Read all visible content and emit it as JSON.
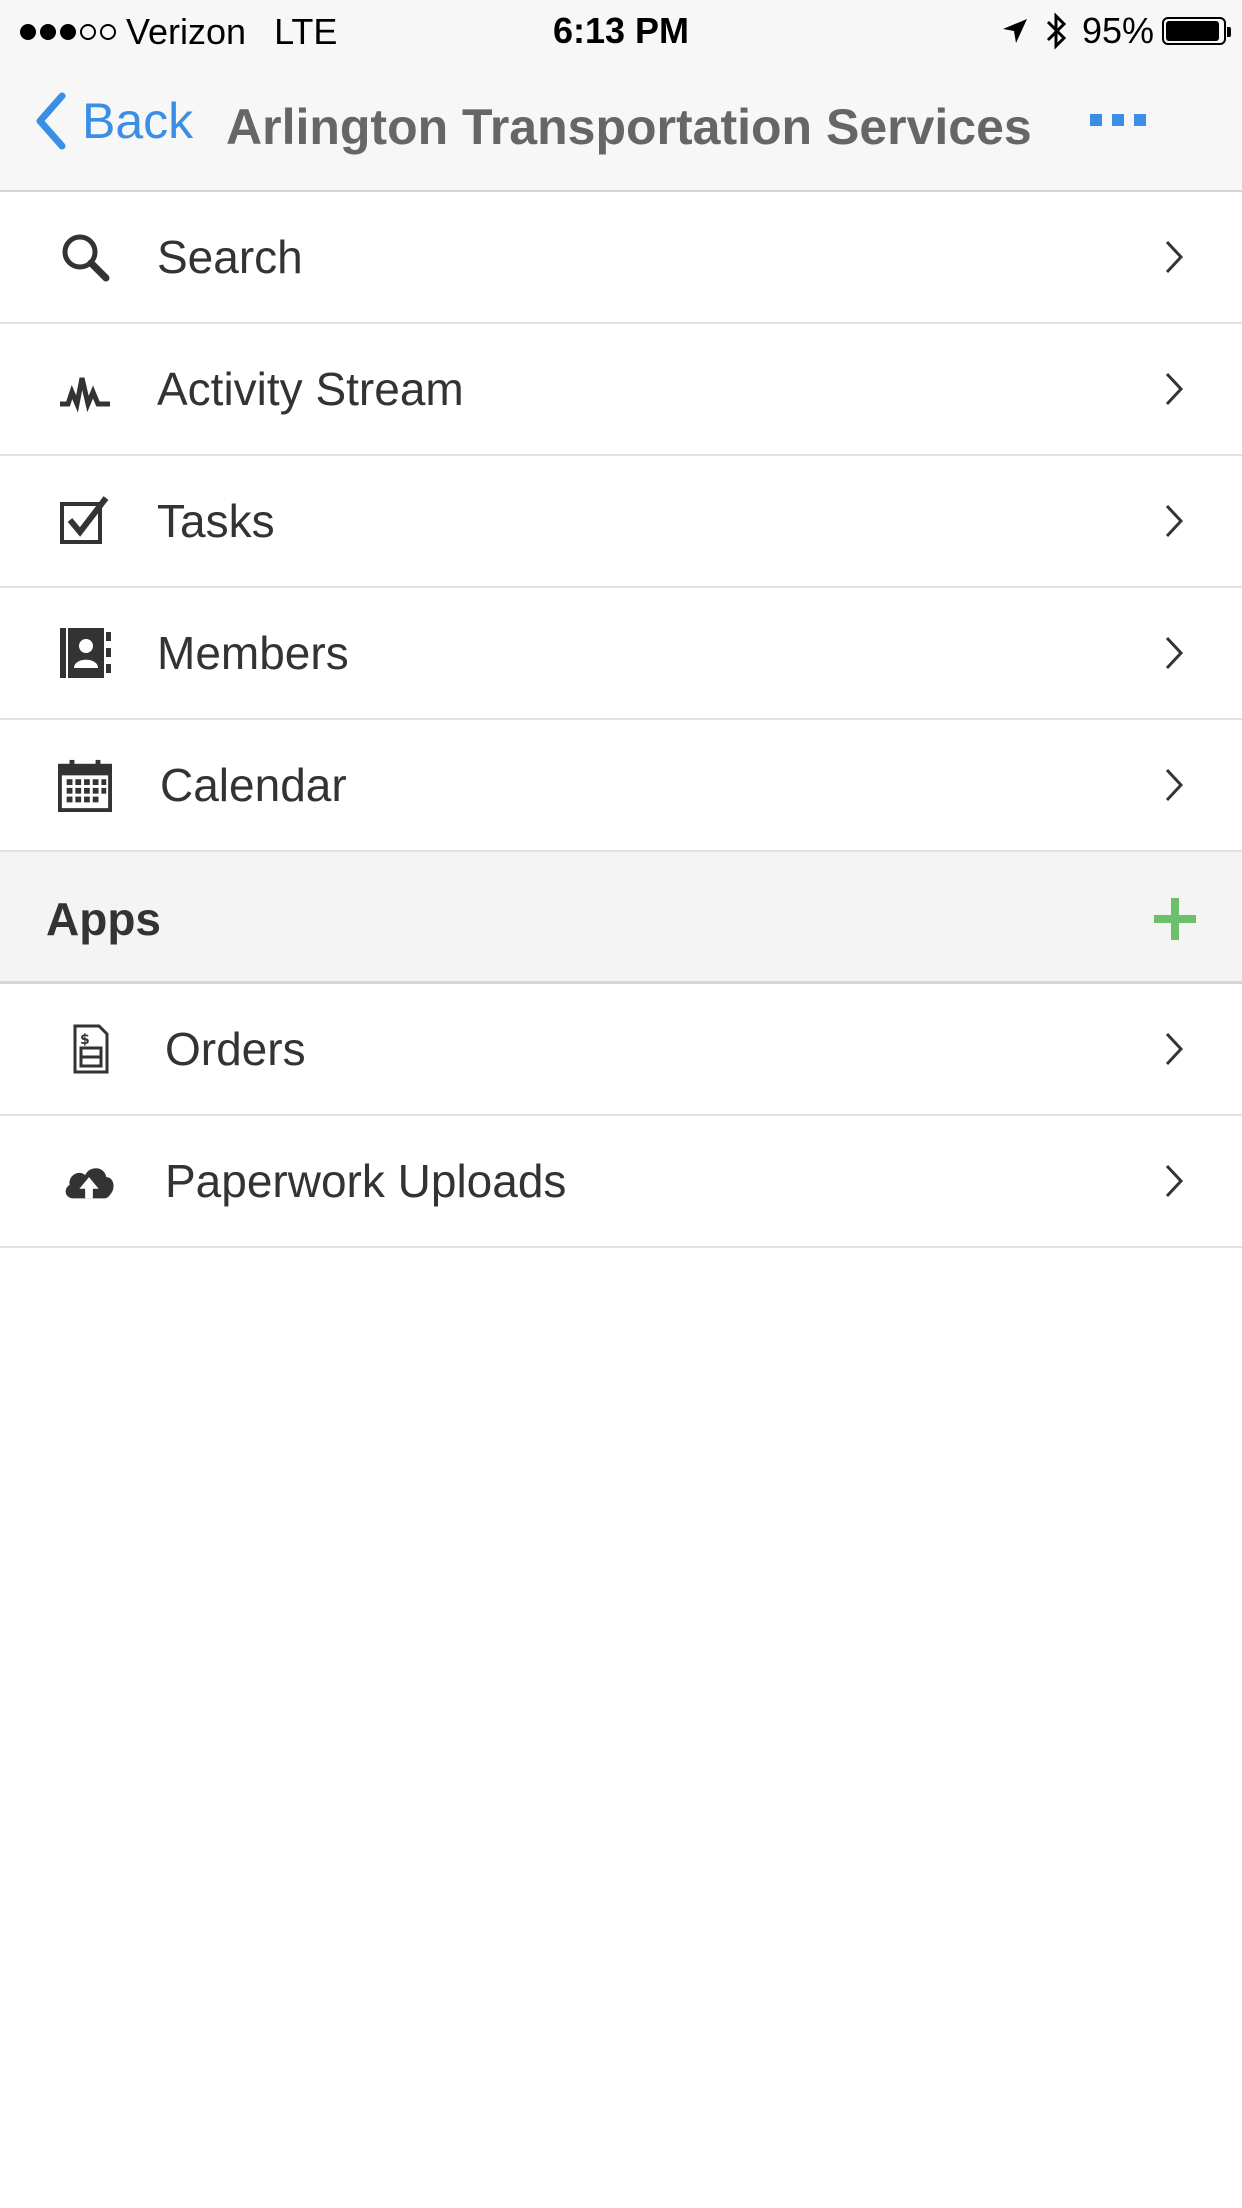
{
  "status_bar": {
    "signal_full": 3,
    "signal_total": 5,
    "carrier": "Verizon",
    "network": "LTE",
    "time": "6:13 PM",
    "battery": "95%",
    "battery_level": 0.95
  },
  "nav": {
    "back_label": "Back",
    "title": "Arlington Transportation Services",
    "more_icon": "ellipsis-icon",
    "accent_color": "#3a8ee6"
  },
  "menu": [
    {
      "label": "Search",
      "icon": "search-icon"
    },
    {
      "label": "Activity Stream",
      "icon": "activity-icon"
    },
    {
      "label": "Tasks",
      "icon": "checkbox-icon"
    },
    {
      "label": "Members",
      "icon": "contacts-icon"
    },
    {
      "label": "Calendar",
      "icon": "calendar-icon"
    }
  ],
  "apps_section": {
    "title": "Apps",
    "add_icon": "plus-icon",
    "add_color": "#6cc06c",
    "items": [
      {
        "label": "Orders",
        "icon": "invoice-icon"
      },
      {
        "label": "Paperwork Uploads",
        "icon": "cloud-upload-icon"
      }
    ]
  }
}
